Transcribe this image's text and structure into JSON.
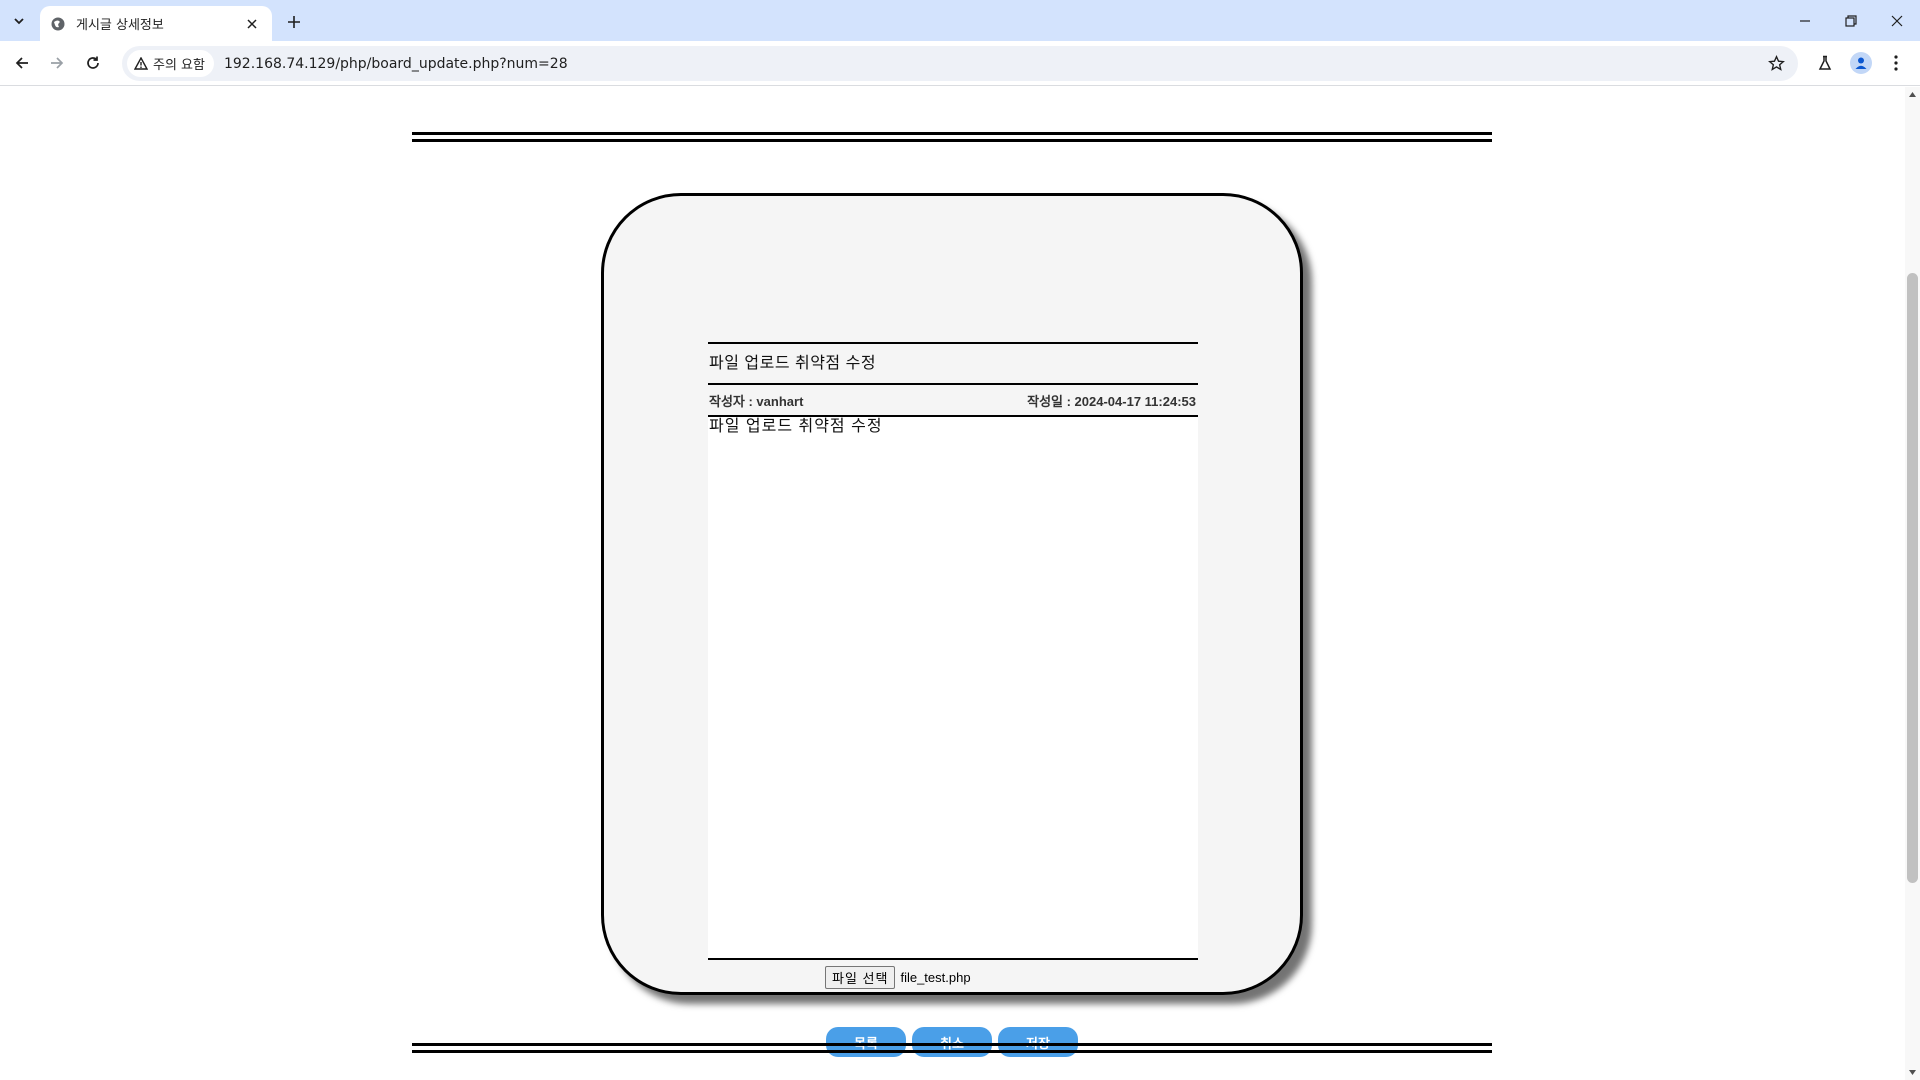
{
  "browser": {
    "tab_title": "게시글 상세정보",
    "security_label": "주의 요함",
    "url": "192.168.74.129/php/board_update.php?num=28"
  },
  "post": {
    "title": "파일 업로드 취약점 수정",
    "author": "작성자 : vanhart",
    "date": "작성일 : 2024-04-17 11:24:53",
    "body": "파일 업로드 취약점 수정"
  },
  "file_input": {
    "button_label": "파일 선택",
    "file_name": "file_test.php"
  },
  "actions": {
    "list_label": "목록",
    "cancel_label": "취소",
    "save_label": "저장"
  },
  "colors": {
    "accent_button": "#4a9fe8",
    "card_bg": "#f5f5f5",
    "chrome_bg": "#d3e3fd"
  }
}
